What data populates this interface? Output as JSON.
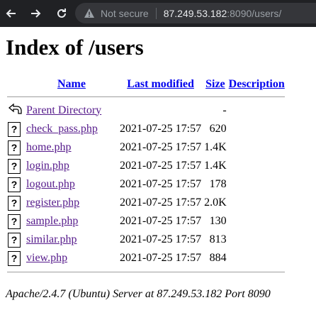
{
  "browser": {
    "security_label": "Not secure",
    "url_host": "87.249.53.182",
    "url_rest": ":8090/users/"
  },
  "page": {
    "title": "Index of /users",
    "columns": {
      "name": "Name",
      "last_modified": "Last modified",
      "size": "Size",
      "description": "Description"
    },
    "parent": {
      "label": "Parent Directory",
      "size": "-",
      "icon": "back-folder-icon"
    },
    "files": [
      {
        "name": "check_pass.php",
        "modified": "2021-07-25 17:57",
        "size": "620",
        "icon": "unknown-file-icon"
      },
      {
        "name": "home.php",
        "modified": "2021-07-25 17:57",
        "size": "1.4K",
        "icon": "unknown-file-icon"
      },
      {
        "name": "login.php",
        "modified": "2021-07-25 17:57",
        "size": "1.4K",
        "icon": "unknown-file-icon"
      },
      {
        "name": "logout.php",
        "modified": "2021-07-25 17:57",
        "size": "178",
        "icon": "unknown-file-icon"
      },
      {
        "name": "register.php",
        "modified": "2021-07-25 17:57",
        "size": "2.0K",
        "icon": "unknown-file-icon"
      },
      {
        "name": "sample.php",
        "modified": "2021-07-25 17:57",
        "size": "130",
        "icon": "unknown-file-icon"
      },
      {
        "name": "similar.php",
        "modified": "2021-07-25 17:57",
        "size": "813",
        "icon": "unknown-file-icon"
      },
      {
        "name": "view.php",
        "modified": "2021-07-25 17:57",
        "size": "884",
        "icon": "unknown-file-icon"
      }
    ],
    "file_icon_glyph": "?",
    "footer": "Apache/2.4.7 (Ubuntu) Server at 87.249.53.182 Port 8090"
  },
  "colors": {
    "chrome_bg": "#202124",
    "omnibox_bg": "#35363a",
    "link_visited": "#551a8b",
    "link": "#0000ee"
  }
}
